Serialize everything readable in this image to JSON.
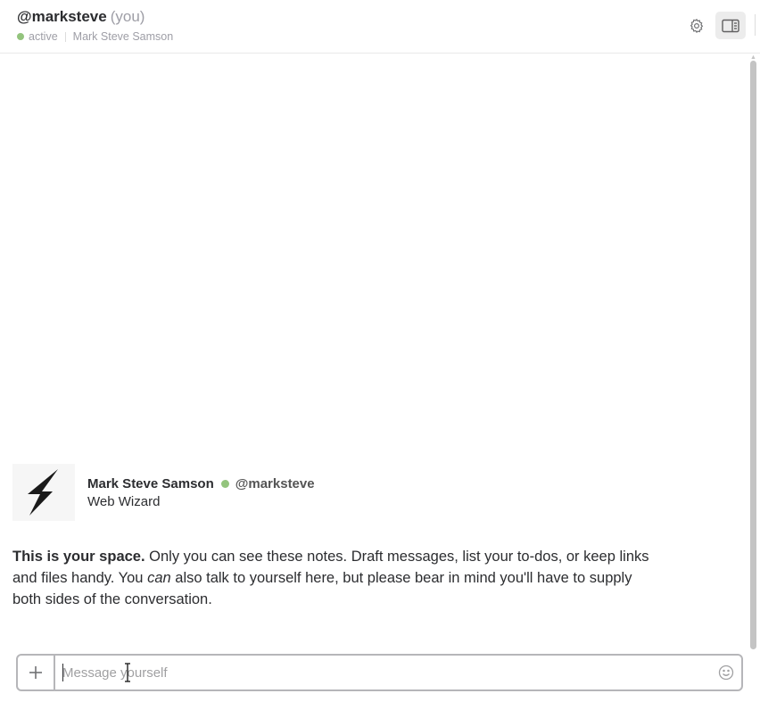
{
  "header": {
    "handle": "@marksteve",
    "you_label": "(you)",
    "status": "active",
    "full_name": "Mark Steve Samson",
    "settings_icon": "gear-icon",
    "details_icon": "sidebar-toggle-icon"
  },
  "intro": {
    "avatar_icon": "lightning-bolt-icon",
    "name": "Mark Steve Samson",
    "handle": "@marksteve",
    "title": "Web Wizard"
  },
  "space_note": {
    "bold": "This is your space.",
    "text1": " Only you can see these notes. Draft messages, list your to-dos, or keep links and files handy. You ",
    "emphasis": "can",
    "text2": " also talk to yourself here, but please bear in mind you'll have to supply both sides of the conversation."
  },
  "composer": {
    "placeholder": "Message yourself",
    "value": "",
    "plus_icon": "plus-icon",
    "emoji_icon": "emoji-icon"
  },
  "colors": {
    "presence": "#93c47d",
    "text": "#2c2d30",
    "muted": "#9e9ea6",
    "border": "#b6b6b9"
  }
}
